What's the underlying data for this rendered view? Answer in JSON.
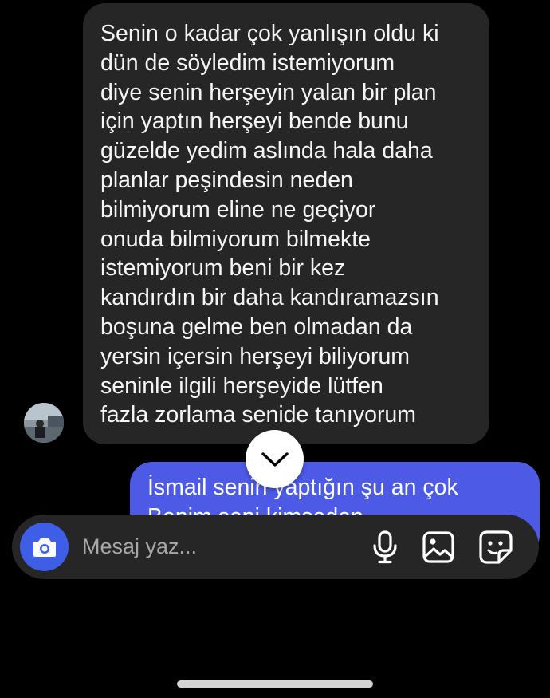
{
  "thread": {
    "incoming_message": {
      "lines": [
        "Senin o kadar çok yanlışın oldu ki",
        "dün de söyledim istemiyorum",
        "diye senin herşeyin yalan bir plan",
        "için yaptın herşeyi bende bunu",
        "güzelde yedim aslında hala daha",
        "planlar peşindesin neden",
        "bilmiyorum eline ne geçiyor",
        "onuda bilmiyorum bilmekte",
        "istemiyorum beni bir kez",
        "kandırdın bir daha kandıramazsın",
        "boşuna gelme ben olmadan da",
        "yersin içersin herşeyi biliyorum",
        "seninle ilgili herşeyide lütfen",
        "fazla zorlama senide tanıyorum"
      ]
    },
    "outgoing_message": {
      "line1": "İsmail senin yaptığın şu an çok",
      "line2": "Benim seni kimseden"
    }
  },
  "composer": {
    "placeholder": "Mesaj yaz..."
  },
  "icons": {
    "camera": "camera-icon",
    "mic": "microphone-icon",
    "gallery": "image-icon",
    "sticker": "sticker-icon",
    "scroll": "chevron-down-icon"
  },
  "colors": {
    "background": "#000000",
    "incoming_bubble": "#262626",
    "outgoing_bubble": "#4c5ae6",
    "camera_button": "#3f5ee8",
    "placeholder": "#a8a8a8"
  }
}
